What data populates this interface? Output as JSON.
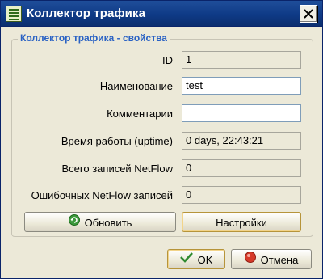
{
  "window": {
    "title": "Коллектор трафика"
  },
  "group": {
    "legend": "Коллектор трафика - свойства"
  },
  "fields": [
    {
      "label": "ID",
      "value": "1"
    },
    {
      "label": "Наименование",
      "value": "test"
    },
    {
      "label": "Комментарии",
      "value": ""
    },
    {
      "label": "Время работы (uptime)",
      "value": "0 days, 22:43:21"
    },
    {
      "label": "Всего записей NetFlow",
      "value": "0"
    },
    {
      "label": "Ошибочных NetFlow записей",
      "value": "0"
    }
  ],
  "buttons": {
    "refresh": "Обновить",
    "settings": "Настройки",
    "ok": "OK",
    "cancel": "Отмена"
  },
  "icons": {
    "window": "list-icon",
    "close": "close-icon",
    "refresh": "refresh-icon",
    "ok": "check-icon",
    "cancel": "cancel-icon"
  }
}
